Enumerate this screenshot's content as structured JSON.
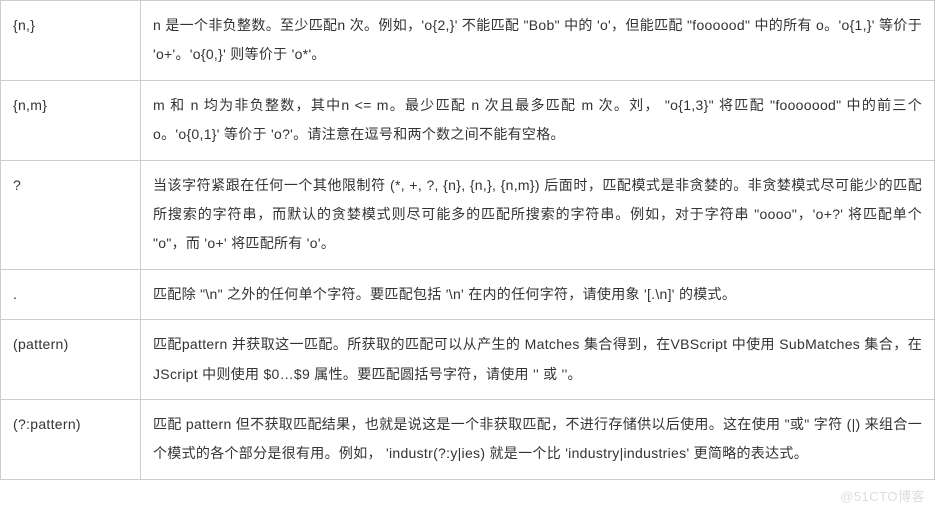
{
  "rows": [
    {
      "pattern": "{n,}",
      "desc": "n 是一个非负整数。至少匹配n 次。例如，'o{2,}' 不能匹配 \"Bob\" 中的 'o'，但能匹配 \"foooood\" 中的所有 o。'o{1,}' 等价于 'o+'。'o{0,}' 则等价于 'o*'。"
    },
    {
      "pattern": "{n,m}",
      "desc": "m 和 n 均为非负整数，其中n <= m。最少匹配 n 次且最多匹配 m 次。刘， \"o{1,3}\" 将匹配 \"fooooood\" 中的前三个 o。'o{0,1}' 等价于 'o?'。请注意在逗号和两个数之间不能有空格。"
    },
    {
      "pattern": "?",
      "desc": "当该字符紧跟在任何一个其他限制符 (*, +, ?, {n}, {n,}, {n,m}) 后面时，匹配模式是非贪婪的。非贪婪模式尽可能少的匹配所搜索的字符串，而默认的贪婪模式则尽可能多的匹配所搜索的字符串。例如，对于字符串 \"oooo\"，'o+?' 将匹配单个 \"o\"，而 'o+' 将匹配所有 'o'。"
    },
    {
      "pattern": ".",
      "desc": "匹配除 \"\\n\" 之外的任何单个字符。要匹配包括 '\\n' 在内的任何字符，请使用象 '[.\\n]' 的模式。"
    },
    {
      "pattern": "(pattern)",
      "desc": "匹配pattern 并获取这一匹配。所获取的匹配可以从产生的 Matches 集合得到，在VBScript 中使用 SubMatches 集合，在JScript 中则使用 $0…$9 属性。要匹配圆括号字符，请使用 '' 或 ''。"
    },
    {
      "pattern": "(?:pattern)",
      "desc": "匹配 pattern 但不获取匹配结果，也就是说这是一个非获取匹配，不进行存储供以后使用。这在使用 \"或\" 字符 (|) 来组合一个模式的各个部分是很有用。例如， 'industr(?:y|ies) 就是一个比 'industry|industries' 更简略的表达式。"
    }
  ],
  "watermark": "@51CTO博客"
}
